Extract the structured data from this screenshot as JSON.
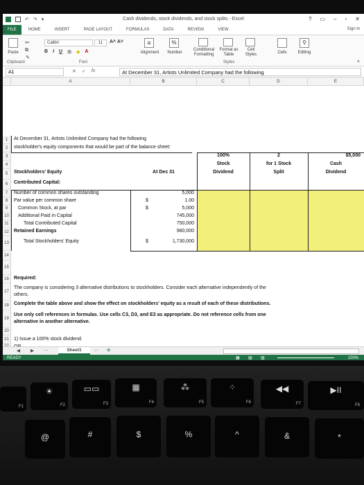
{
  "window": {
    "title": "Cash dividends, stock dividends, and stock splits - Excel",
    "controls": [
      "?",
      "▭",
      "–",
      "▫",
      "✕"
    ]
  },
  "ribbon": {
    "tabs": [
      "FILE",
      "HOME",
      "INSERT",
      "PAGE LAYOUT",
      "FORMULAS",
      "DATA",
      "REVIEW",
      "VIEW"
    ],
    "sign_in": "Sign in",
    "paste_label": "Paste",
    "font_name": "Calibri",
    "font_size": "11",
    "bold": "B",
    "italic": "I",
    "underline": "U",
    "grow_shrink": "A˄ A˅",
    "alignment": "Alignment",
    "number": "Number",
    "conditional_formatting": "Conditional Formatting",
    "format_as_table": "Format as Table",
    "cell_styles": "Cell Styles",
    "cells": "Cells",
    "editing": "Editing",
    "group_clipboard": "Clipboard",
    "group_font": "Font",
    "group_styles": "Styles"
  },
  "formula_bar": {
    "name_box": "A1",
    "fx": "fx",
    "formula": "At December 31, Artists Unlimited Company had the following"
  },
  "grid": {
    "columns": [
      "A",
      "B",
      "C",
      "D",
      "E"
    ],
    "rows": [
      "1",
      "2",
      "3",
      "4",
      "5",
      "6",
      "7",
      "8",
      "9",
      "10",
      "11",
      "12",
      "13",
      "14",
      "15",
      "16",
      "17",
      "18",
      "19",
      "20",
      "21",
      "22"
    ],
    "r1": "At December 31, Artists Unlimited Company had the following",
    "r2": "stockholder's equity components that would be part of the balance sheet:",
    "c3": "100%",
    "c4": "Stock",
    "c5": "Dividend",
    "d3": "2",
    "d4": "for 1 Stock",
    "d5": "Split",
    "e3": "$5,000",
    "e4": "Cash",
    "e5": "Dividend",
    "a5": "Stockholders' Equity",
    "b5": "At Dec 31",
    "a6": "Contributed Capital:",
    "a7": "Number of common shares outstanding",
    "b7": "5,000",
    "a8": "Par value per common share",
    "b8_sym": "$",
    "b8": "1.00",
    "a9": "Common Stock, at par",
    "b9_sym": "$",
    "b9": "5,000",
    "a10": "Additional Paid in Capital",
    "b10": "745,000",
    "a11": "Total Contributed Capital",
    "b11": "750,000",
    "a12": "Retained Earnings",
    "b12": "980,000",
    "a13": "Total Stockholders' Equity",
    "b13_sym": "$",
    "b13": "1,730,000",
    "a16": "Required:",
    "a17": "The company is considering 3 alternative distributions to stockholders. Consider each alternative independently of the",
    "a17b": "others.",
    "a18": "Complete the table above and show the effect on stockholders' equity as a result of each of these distributions.",
    "a19": "Use only cell references in formulas. Use cells C3, D3, and E3 as appropriate. Do not reference cells from one",
    "a19b": "alternative in another alternative.",
    "a21": "1) Issue a 100% stock dividend.",
    "a22": "OR"
  },
  "sheets": {
    "active": "Sheet1",
    "more": "...",
    "add": "⊕",
    "nav_prev": "◀",
    "nav_next": "▶"
  },
  "status": {
    "mode": "READY",
    "zoom": "100%"
  },
  "keyboard": {
    "f1": "F1",
    "f2": "F2",
    "f3": "F3",
    "f4": "F4",
    "f5": "F5",
    "f6": "F6",
    "f7": "F7",
    "f8": "F8",
    "k2": "@",
    "k3": "#",
    "k4": "$",
    "k5": "%",
    "k6": "^",
    "k7": "&",
    "k8": "*"
  }
}
